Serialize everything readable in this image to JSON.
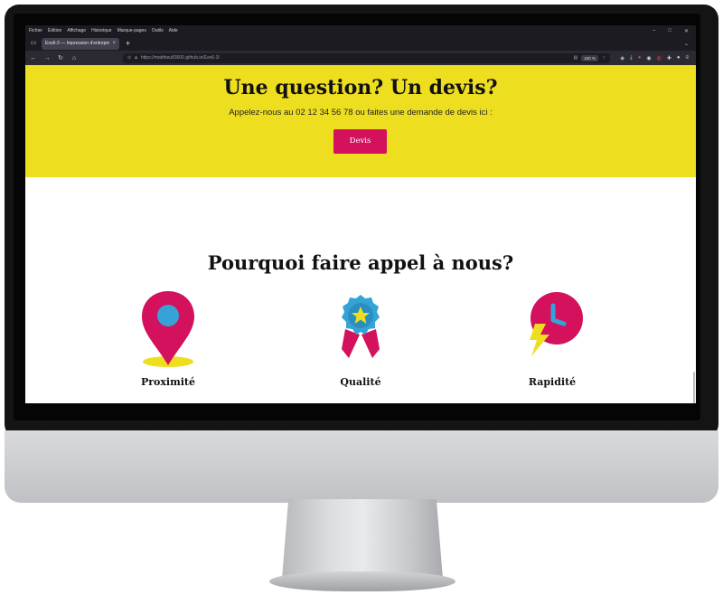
{
  "browser": {
    "menu": [
      "Fichier",
      "Édition",
      "Affichage",
      "Historique",
      "Marque-pages",
      "Outils",
      "Aide"
    ],
    "tab_title": "Exo6-3 — Impression d'entreprise",
    "tab_close": "×",
    "new_tab": "+",
    "url": "https://matthieu83600.github.io/Exo6-3/",
    "zoom": "150 %"
  },
  "cta": {
    "title": "Une question? Un devis?",
    "subtitle": "Appelez-nous au 02 12 34 56 78 ou faites une demande de devis ici :",
    "button_label": "Devis",
    "background_color": "#eede20",
    "button_color": "#d3115d"
  },
  "why": {
    "title": "Pourquoi faire appel à nous?",
    "features": [
      {
        "label": "Proximité",
        "icon": "location-pin-icon"
      },
      {
        "label": "Qualité",
        "icon": "award-ribbon-icon"
      },
      {
        "label": "Rapidité",
        "icon": "fast-clock-icon"
      }
    ]
  },
  "colors": {
    "magenta": "#d3115d",
    "blue": "#35a3d6",
    "yellow": "#eede20"
  }
}
